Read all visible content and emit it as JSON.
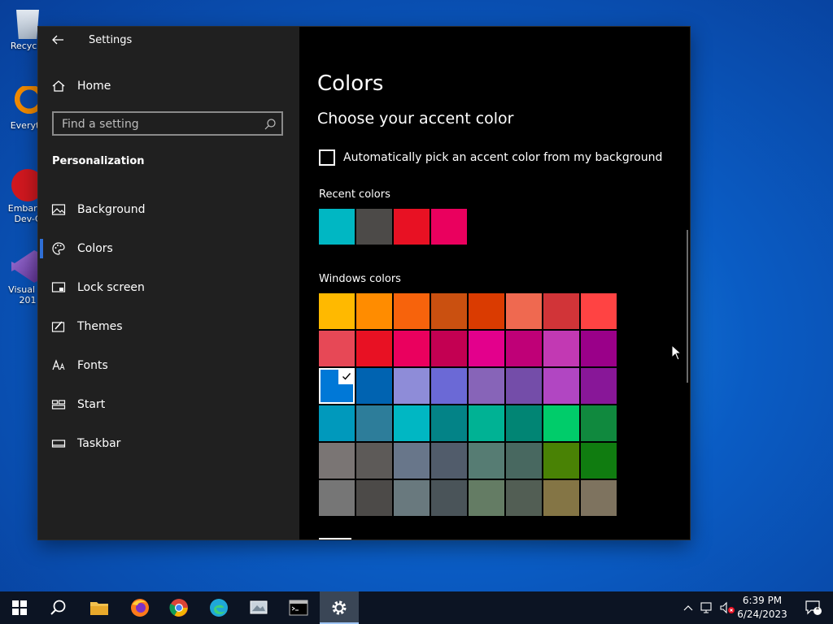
{
  "desktop": {
    "icons": [
      {
        "label1": "Recycle",
        "label2": ""
      },
      {
        "label1": "Everyth",
        "label2": ""
      },
      {
        "label1": "Embarca",
        "label2": "Dev-C"
      },
      {
        "label1": "Visual St",
        "label2": "201"
      }
    ]
  },
  "window": {
    "title": "Settings"
  },
  "sidebar": {
    "home_label": "Home",
    "search_placeholder": "Find a setting",
    "section": "Personalization",
    "items": [
      {
        "label": "Background",
        "icon": "picture-icon"
      },
      {
        "label": "Colors",
        "icon": "palette-icon",
        "selected": true
      },
      {
        "label": "Lock screen",
        "icon": "lock-screen-icon"
      },
      {
        "label": "Themes",
        "icon": "themes-icon"
      },
      {
        "label": "Fonts",
        "icon": "fonts-icon"
      },
      {
        "label": "Start",
        "icon": "start-icon"
      },
      {
        "label": "Taskbar",
        "icon": "taskbar-icon"
      }
    ]
  },
  "content": {
    "title": "Colors",
    "subtitle": "Choose your accent color",
    "auto_pick_label": "Automatically pick an accent color from my background",
    "auto_pick_checked": false,
    "recent_label": "Recent colors",
    "recent_colors": [
      "#00b7c3",
      "#4c4a48",
      "#e81123",
      "#ea005e"
    ],
    "windows_label": "Windows colors",
    "windows_colors": [
      "#ffb900",
      "#ff8c00",
      "#f7630c",
      "#ca5010",
      "#da3b01",
      "#ef6950",
      "#d13438",
      "#ff4343",
      "#e74856",
      "#e81123",
      "#ea005e",
      "#c30052",
      "#e3008c",
      "#bf0077",
      "#c239b3",
      "#9a0089",
      "#0078d7",
      "#0063b1",
      "#8e8cd8",
      "#6b69d6",
      "#8764b8",
      "#744da9",
      "#b146c2",
      "#881798",
      "#0099bc",
      "#2d7d9a",
      "#00b7c3",
      "#038387",
      "#00b294",
      "#018574",
      "#00cc6a",
      "#10893e",
      "#7a7574",
      "#5d5a58",
      "#68768a",
      "#515c6b",
      "#567c73",
      "#486860",
      "#498205",
      "#107c10",
      "#767676",
      "#4c4a48",
      "#69797e",
      "#4a5459",
      "#647c64",
      "#525e54",
      "#847545",
      "#7e735f"
    ],
    "selected_index": 16
  },
  "taskbar": {
    "apps": [
      "start-icon",
      "search-icon",
      "file-explorer-icon",
      "firefox-icon",
      "chrome-icon",
      "edge-icon",
      "app-icon",
      "terminal-icon",
      "settings-icon"
    ],
    "time": "6:39 PM",
    "date": "6/24/2023",
    "notification_count": "1"
  }
}
